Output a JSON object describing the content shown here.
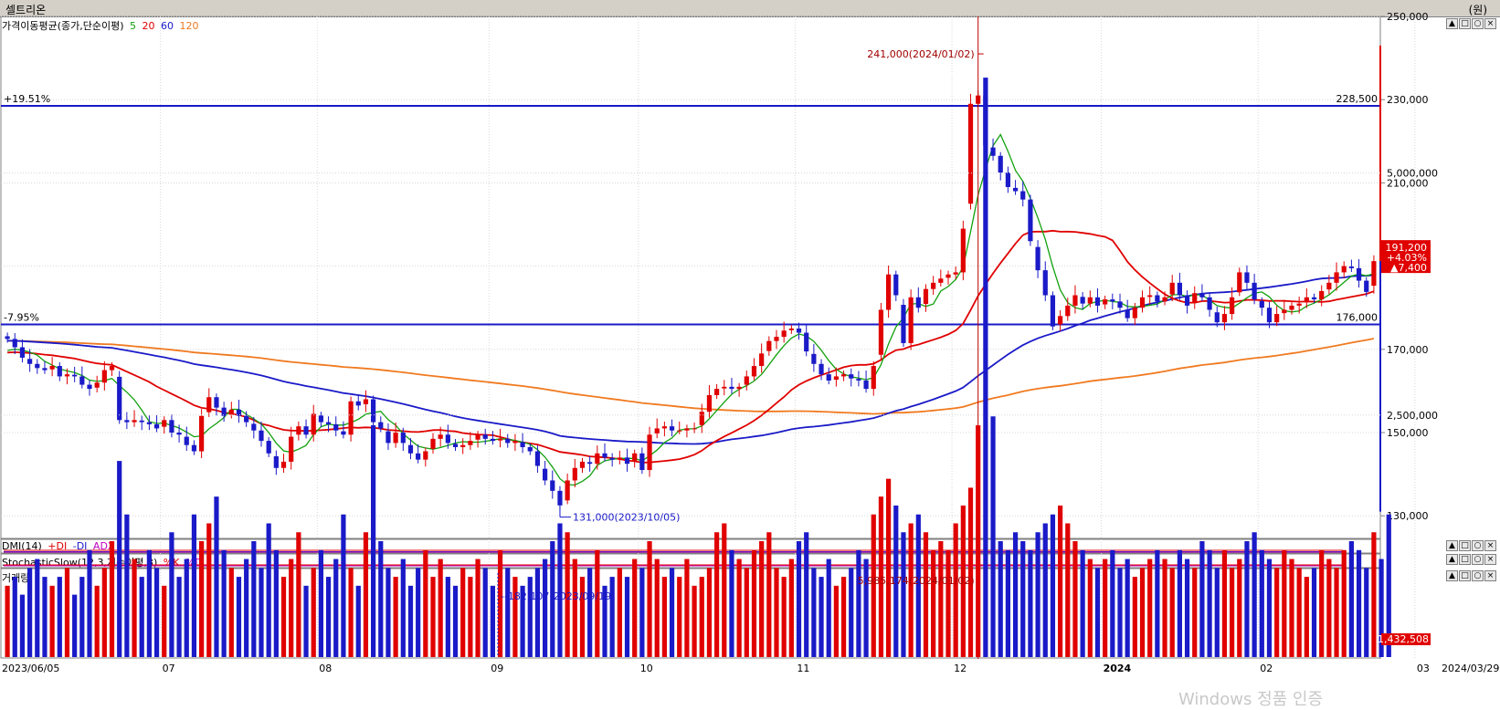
{
  "window": {
    "title": "셀트리온",
    "unit": "(원)"
  },
  "panes": {
    "price": {
      "label": "가격이동평균(종가,단순이평)",
      "periods": [
        "5",
        "20",
        "60",
        "120"
      ],
      "period_colors": [
        "#13a10e",
        "#e00000",
        "#1a1ac8",
        "#f07a20"
      ]
    },
    "dmi": {
      "label": "DMI(14)",
      "items": [
        "+DI",
        "-DI",
        "ADX"
      ]
    },
    "stoch": {
      "label": "StochasticSlow(12,3,지수이평,3)",
      "items": [
        "%K",
        "%D"
      ]
    },
    "volume": {
      "label": "거래량"
    }
  },
  "buttons": [
    "▲",
    "□",
    "○",
    "×"
  ],
  "watermark": "Windows 정품 인증",
  "chart_data": {
    "type": "candlestick",
    "x_start": "2023/06/05",
    "x_end": "2024/03/29",
    "x_tick_labels": [
      "2023/06/05",
      "07",
      "08",
      "09",
      "10",
      "11",
      "12",
      "2024",
      "02",
      "03",
      "2024/03/29"
    ],
    "y_ticks": [
      "130,000",
      "150,000",
      "170,000",
      "190,000",
      "210,000",
      "230,000",
      "250,000"
    ],
    "volume_ticks": [
      "2,500,000",
      "5,000,000"
    ],
    "hlines": [
      {
        "label_left": "+19.51%",
        "label_right": "228,500",
        "value": 228500
      },
      {
        "label_left": "-7.95%",
        "label_right": "176,000",
        "value": 176000
      }
    ],
    "annotations": {
      "high": "241,000(2024/01/02)",
      "low": "131,000(2023/10/05)",
      "vol_high": "5,985,174(2024/01/02)",
      "vol_other": "182,107(2023/09/19)"
    },
    "last": {
      "price": "191,200",
      "change_pct": "+4.03%",
      "change": "▲7,400",
      "volume": "1,432,508"
    },
    "closes": [
      172500,
      170500,
      168000,
      166500,
      165500,
      165000,
      166000,
      163500,
      164000,
      163500,
      161500,
      160500,
      162000,
      165000,
      166000,
      153000,
      152500,
      153000,
      152500,
      152000,
      151000,
      153000,
      150000,
      149500,
      147000,
      145500,
      154000,
      158500,
      156000,
      154000,
      155500,
      154000,
      152500,
      150500,
      148000,
      145000,
      141500,
      143000,
      149000,
      151500,
      149500,
      154500,
      152500,
      152000,
      150500,
      149500,
      157500,
      156500,
      158000,
      152500,
      151000,
      147500,
      150000,
      147500,
      145000,
      143500,
      145500,
      148500,
      149500,
      147500,
      146500,
      147000,
      148000,
      149500,
      148500,
      148000,
      148500,
      147500,
      148000,
      146500,
      145500,
      142000,
      138500,
      136000,
      132500,
      138500,
      141500,
      143000,
      142500,
      145000,
      144000,
      143500,
      144000,
      142500,
      145000,
      141000,
      149500,
      151000,
      151500,
      150500,
      150500,
      151000,
      151000,
      155000,
      159000,
      160500,
      161000,
      160500,
      161000,
      163500,
      166000,
      169000,
      172000,
      173000,
      174500,
      175000,
      174000,
      169500,
      166500,
      164000,
      162500,
      163500,
      164000,
      163000,
      162500,
      160500,
      166000,
      179500,
      188000,
      183000,
      171500,
      182500,
      180000,
      184500,
      186000,
      187000,
      188000,
      188500,
      199000,
      229000,
      231000,
      219000,
      216500,
      212500,
      209000,
      208000,
      206000,
      196000,
      189000,
      183000,
      175500,
      178000,
      180500,
      183000,
      181000,
      182500,
      180500,
      182000,
      181500,
      180000,
      177500,
      180000,
      182500,
      183000,
      181500,
      182500,
      186000,
      183000,
      180500,
      183500,
      182500,
      179500,
      176500,
      178500,
      182500,
      188500,
      186000,
      182000,
      180000,
      176500,
      178500,
      179500,
      180500,
      181000,
      182500,
      182000,
      184000,
      186000,
      188500,
      190000,
      189500,
      186500,
      183800,
      191200
    ],
    "volume_units": [
      0.8,
      0.9,
      0.7,
      1.0,
      1.1,
      0.9,
      0.8,
      0.9,
      1.0,
      0.7,
      0.9,
      1.2,
      0.8,
      1.0,
      1.3,
      2.2,
      1.6,
      1.1,
      0.9,
      1.2,
      1.0,
      0.8,
      1.4,
      0.9,
      1.1,
      1.6,
      1.3,
      1.5,
      1.8,
      1.2,
      1.0,
      0.9,
      1.1,
      1.3,
      1.0,
      1.5,
      1.2,
      0.9,
      1.1,
      1.4,
      0.8,
      1.0,
      1.2,
      0.9,
      1.1,
      1.6,
      1.0,
      0.8,
      1.4,
      2.6,
      1.3,
      1.0,
      0.9,
      1.1,
      0.8,
      1.0,
      1.2,
      0.9,
      1.1,
      0.9,
      0.8,
      1.0,
      0.9,
      1.1,
      1.0,
      0.8,
      1.2,
      1.0,
      0.9,
      0.8,
      0.9,
      1.0,
      1.1,
      1.3,
      1.5,
      1.4,
      1.1,
      0.9,
      1.0,
      1.2,
      0.8,
      0.9,
      1.0,
      0.9,
      1.1,
      1.0,
      1.3,
      1.1,
      0.9,
      1.0,
      0.9,
      1.1,
      0.8,
      0.9,
      1.0,
      1.4,
      1.5,
      1.2,
      1.1,
      1.0,
      1.2,
      1.3,
      1.4,
      1.0,
      0.9,
      1.1,
      1.3,
      1.4,
      1.0,
      0.9,
      1.1,
      0.8,
      0.9,
      1.0,
      1.2,
      1.1,
      1.6,
      1.8,
      2.0,
      1.7,
      1.4,
      1.5,
      1.6,
      1.4,
      1.2,
      1.3,
      1.2,
      1.5,
      1.7,
      1.9,
      2.6,
      6.5,
      2.7,
      1.3,
      1.2,
      1.4,
      1.3,
      1.2,
      1.4,
      1.5,
      1.6,
      1.7,
      1.5,
      1.3,
      1.2,
      1.1,
      1.0,
      1.1,
      1.2,
      1.0,
      1.1,
      0.9,
      1.0,
      1.1,
      1.2,
      1.1,
      1.0,
      1.2,
      1.1,
      1.0,
      1.3,
      1.2,
      1.0,
      1.2,
      1.0,
      1.1,
      1.3,
      1.4,
      1.2,
      1.1,
      1.0,
      1.2,
      1.1,
      1.0,
      0.9,
      1.0,
      1.2,
      1.1,
      1.0,
      1.2,
      1.3,
      1.2,
      1.0,
      1.4,
      1.1,
      1.6
    ]
  }
}
